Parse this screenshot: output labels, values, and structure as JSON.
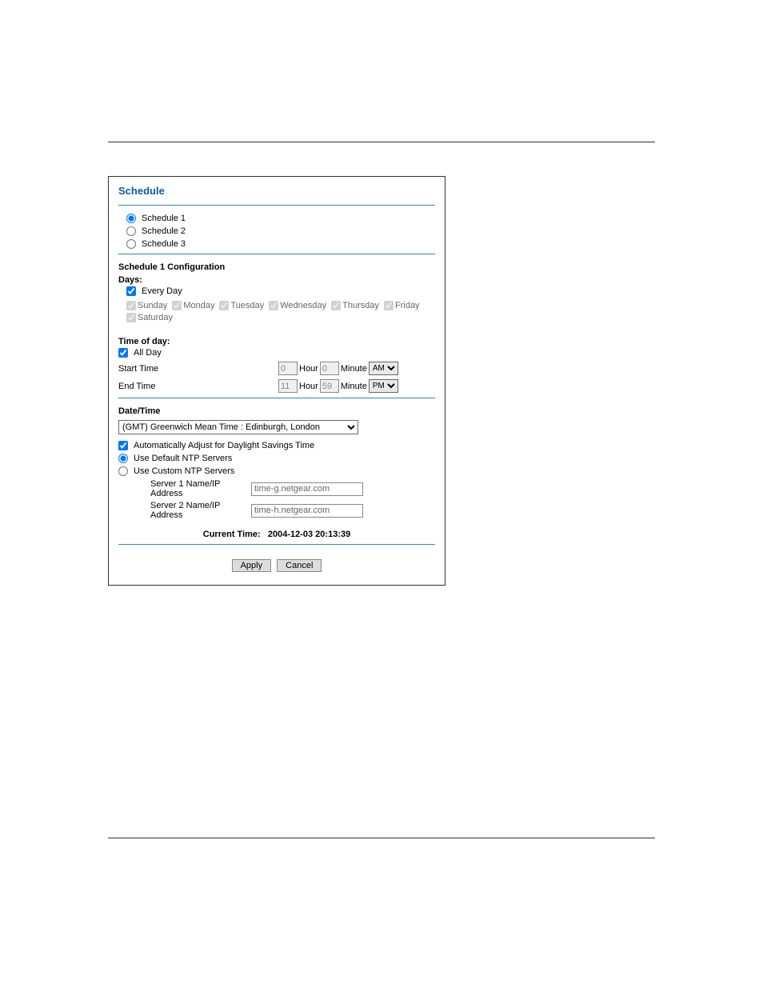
{
  "panel": {
    "title": "Schedule",
    "schedules": [
      "Schedule 1",
      "Schedule 2",
      "Schedule 3"
    ],
    "selected_schedule": 0,
    "config_heading": "Schedule 1 Configuration",
    "days_label": "Days:",
    "every_day_label": "Every Day",
    "days": [
      "Sunday",
      "Monday",
      "Tuesday",
      "Wednesday",
      "Thursday",
      "Friday",
      "Saturday"
    ],
    "time_of_day_label": "Time of day:",
    "all_day_label": "All Day",
    "start_time_label": "Start Time",
    "end_time_label": "End Time",
    "hour_label": "Hour",
    "minute_label": "Minute",
    "start_hour": "0",
    "start_minute": "0",
    "start_ampm": "AM",
    "end_hour": "11",
    "end_minute": "59",
    "end_ampm": "PM",
    "datetime_heading": "Date/Time",
    "timezone_value": "(GMT) Greenwich Mean Time : Edinburgh, London",
    "dst_label": "Automatically Adjust for Daylight Savings Time",
    "default_ntp_label": "Use Default NTP Servers",
    "custom_ntp_label": "Use Custom NTP Servers",
    "server1_label": "Server 1 Name/IP Address",
    "server2_label": "Server 2 Name/IP Address",
    "server1_value": "time-g.netgear.com",
    "server2_value": "time-h.netgear.com",
    "current_time_label": "Current Time:",
    "current_time_value": "2004-12-03 20:13:39",
    "apply_label": "Apply",
    "cancel_label": "Cancel"
  }
}
